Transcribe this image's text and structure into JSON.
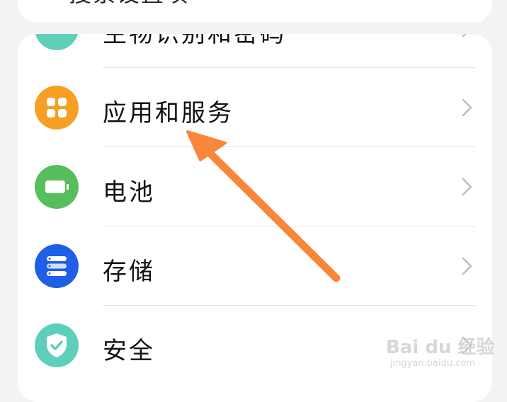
{
  "search": {
    "placeholder_text": "搜索设置项"
  },
  "settings": {
    "items": [
      {
        "label": "生物识别和密码",
        "icon": "fingerprint-icon",
        "color": "#5fcfb9"
      },
      {
        "label": "应用和服务",
        "icon": "apps-grid-icon",
        "color": "#f5a023"
      },
      {
        "label": "电池",
        "icon": "battery-icon",
        "color": "#56bf5c"
      },
      {
        "label": "存储",
        "icon": "storage-icon",
        "color": "#1f5fe6"
      },
      {
        "label": "安全",
        "icon": "shield-check-icon",
        "color": "#5ecfbb"
      }
    ]
  },
  "annotation": {
    "arrow_color": "#f8873c"
  },
  "watermark": {
    "brand": "Bai du 经验",
    "url": "jingyan.baidu.com"
  }
}
